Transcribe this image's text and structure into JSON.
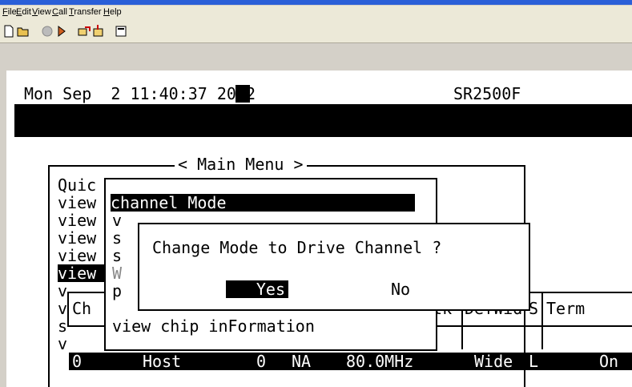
{
  "menu": [
    "File",
    "Edit",
    "View",
    "Call",
    "Transfer",
    "Help"
  ],
  "toolbar_icons": [
    "new-icon",
    "open-icon",
    "disconnect-icon",
    "connect-icon",
    "send-icon",
    "receive-icon",
    "properties-icon"
  ],
  "terminal": {
    "datetime": "Mon Sep  2 11:40:37 2002",
    "model": "SR2500F",
    "main_menu_title": "< Main Menu >",
    "main_items": [
      "Quic",
      "view",
      "view",
      "view",
      "view",
      "view",
      "v",
      "v",
      "s",
      "v"
    ],
    "channel_submenu": {
      "title": "channel Mode",
      "letters": [
        "v",
        "s",
        "s",
        "W",
        "p"
      ],
      "last_item": "view chip inFormation"
    },
    "dialog": {
      "question": "Change Mode to Drive Channel ?",
      "yes": "Yes",
      "no": "No"
    },
    "table": {
      "headers": [
        "Ch",
        "Clk",
        "DefWid",
        "S",
        "Term"
      ],
      "row": [
        "0",
        "Host",
        "0",
        "NA",
        "80.0MHz",
        "Wide",
        "L",
        "On"
      ]
    }
  }
}
